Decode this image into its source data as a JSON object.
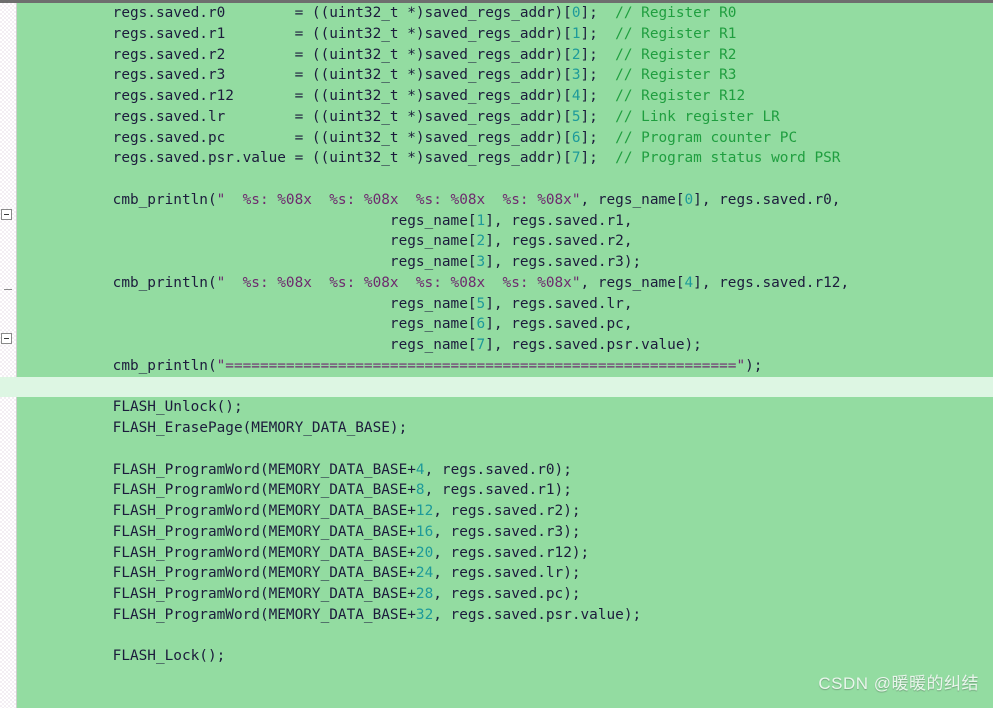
{
  "editor": {
    "background_color": "#93dca1",
    "caret_line_color": "#ddf6e3",
    "text_color": "#1c1c3c",
    "comment_color": "#1f9e3f",
    "string_color": "#6e2a6e",
    "number_color": "#1e9a9a",
    "language": "C"
  },
  "gutter": {
    "fold_markers": [
      {
        "name": "fold-marker-collapse-1",
        "glyph": "minus"
      },
      {
        "name": "fold-marker-collapse-2",
        "glyph": "minus"
      }
    ]
  },
  "watermark": {
    "text": "CSDN @暖暖的纠结"
  },
  "code": {
    "lines": [
      {
        "id": "line-assign-r0",
        "indent": "    ",
        "segments": [
          {
            "type": "plain",
            "text": "regs.saved.r0        = ((uint32_t *)saved_regs_addr)["
          },
          {
            "type": "number",
            "text": "0"
          },
          {
            "type": "plain",
            "text": "];  "
          },
          {
            "type": "comment",
            "text": "// Register R0"
          }
        ]
      },
      {
        "id": "line-assign-r1",
        "indent": "    ",
        "segments": [
          {
            "type": "plain",
            "text": "regs.saved.r1        = ((uint32_t *)saved_regs_addr)["
          },
          {
            "type": "number",
            "text": "1"
          },
          {
            "type": "plain",
            "text": "];  "
          },
          {
            "type": "comment",
            "text": "// Register R1"
          }
        ]
      },
      {
        "id": "line-assign-r2",
        "indent": "    ",
        "segments": [
          {
            "type": "plain",
            "text": "regs.saved.r2        = ((uint32_t *)saved_regs_addr)["
          },
          {
            "type": "number",
            "text": "2"
          },
          {
            "type": "plain",
            "text": "];  "
          },
          {
            "type": "comment",
            "text": "// Register R2"
          }
        ]
      },
      {
        "id": "line-assign-r3",
        "indent": "    ",
        "segments": [
          {
            "type": "plain",
            "text": "regs.saved.r3        = ((uint32_t *)saved_regs_addr)["
          },
          {
            "type": "number",
            "text": "3"
          },
          {
            "type": "plain",
            "text": "];  "
          },
          {
            "type": "comment",
            "text": "// Register R3"
          }
        ]
      },
      {
        "id": "line-assign-r12",
        "indent": "    ",
        "segments": [
          {
            "type": "plain",
            "text": "regs.saved.r12       = ((uint32_t *)saved_regs_addr)["
          },
          {
            "type": "number",
            "text": "4"
          },
          {
            "type": "plain",
            "text": "];  "
          },
          {
            "type": "comment",
            "text": "// Register R12"
          }
        ]
      },
      {
        "id": "line-assign-lr",
        "indent": "    ",
        "segments": [
          {
            "type": "plain",
            "text": "regs.saved.lr        = ((uint32_t *)saved_regs_addr)["
          },
          {
            "type": "number",
            "text": "5"
          },
          {
            "type": "plain",
            "text": "];  "
          },
          {
            "type": "comment",
            "text": "// Link register LR"
          }
        ]
      },
      {
        "id": "line-assign-pc",
        "indent": "    ",
        "segments": [
          {
            "type": "plain",
            "text": "regs.saved.pc        = ((uint32_t *)saved_regs_addr)["
          },
          {
            "type": "number",
            "text": "6"
          },
          {
            "type": "plain",
            "text": "];  "
          },
          {
            "type": "comment",
            "text": "// Program counter PC"
          }
        ]
      },
      {
        "id": "line-assign-psr",
        "indent": "    ",
        "segments": [
          {
            "type": "plain",
            "text": "regs.saved.psr.value = ((uint32_t *)saved_regs_addr)["
          },
          {
            "type": "number",
            "text": "7"
          },
          {
            "type": "plain",
            "text": "];  "
          },
          {
            "type": "comment",
            "text": "// Program status word PSR"
          }
        ]
      },
      {
        "id": "line-blank-1",
        "indent": "",
        "segments": []
      },
      {
        "id": "line-println-1",
        "indent": "    ",
        "segments": [
          {
            "type": "plain",
            "text": "cmb_println("
          },
          {
            "type": "string",
            "text": "\"  %s: %08x  %s: %08x  %s: %08x  %s: %08x\""
          },
          {
            "type": "plain",
            "text": ", regs_name["
          },
          {
            "type": "number",
            "text": "0"
          },
          {
            "type": "plain",
            "text": "], regs.saved.r0,"
          }
        ]
      },
      {
        "id": "line-println-1-arg2",
        "indent": "                                    ",
        "segments": [
          {
            "type": "plain",
            "text": "regs_name["
          },
          {
            "type": "number",
            "text": "1"
          },
          {
            "type": "plain",
            "text": "], regs.saved.r1,"
          }
        ]
      },
      {
        "id": "line-println-1-arg3",
        "indent": "                                    ",
        "segments": [
          {
            "type": "plain",
            "text": "regs_name["
          },
          {
            "type": "number",
            "text": "2"
          },
          {
            "type": "plain",
            "text": "], regs.saved.r2,"
          }
        ]
      },
      {
        "id": "line-println-1-arg4",
        "indent": "                                    ",
        "segments": [
          {
            "type": "plain",
            "text": "regs_name["
          },
          {
            "type": "number",
            "text": "3"
          },
          {
            "type": "plain",
            "text": "], regs.saved.r3);"
          }
        ]
      },
      {
        "id": "line-println-2",
        "indent": "    ",
        "segments": [
          {
            "type": "plain",
            "text": "cmb_println("
          },
          {
            "type": "string",
            "text": "\"  %s: %08x  %s: %08x  %s: %08x  %s: %08x\""
          },
          {
            "type": "plain",
            "text": ", regs_name["
          },
          {
            "type": "number",
            "text": "4"
          },
          {
            "type": "plain",
            "text": "], regs.saved.r12,"
          }
        ]
      },
      {
        "id": "line-println-2-arg2",
        "indent": "                                    ",
        "segments": [
          {
            "type": "plain",
            "text": "regs_name["
          },
          {
            "type": "number",
            "text": "5"
          },
          {
            "type": "plain",
            "text": "], regs.saved.lr,"
          }
        ]
      },
      {
        "id": "line-println-2-arg3",
        "indent": "                                    ",
        "segments": [
          {
            "type": "plain",
            "text": "regs_name["
          },
          {
            "type": "number",
            "text": "6"
          },
          {
            "type": "plain",
            "text": "], regs.saved.pc,"
          }
        ]
      },
      {
        "id": "line-println-2-arg4",
        "indent": "                                    ",
        "segments": [
          {
            "type": "plain",
            "text": "regs_name["
          },
          {
            "type": "number",
            "text": "7"
          },
          {
            "type": "plain",
            "text": "], regs.saved.psr.value);"
          }
        ]
      },
      {
        "id": "line-println-separator",
        "indent": "    ",
        "segments": [
          {
            "type": "plain",
            "text": "cmb_println("
          },
          {
            "type": "string",
            "text": "\"===========================================================\""
          },
          {
            "type": "plain",
            "text": ");"
          }
        ]
      },
      {
        "id": "line-blank-caret",
        "indent": "",
        "caret": true,
        "segments": []
      },
      {
        "id": "line-flash-unlock",
        "indent": "    ",
        "segments": [
          {
            "type": "plain",
            "text": "FLASH_Unlock();"
          }
        ]
      },
      {
        "id": "line-flash-erasepage",
        "indent": "    ",
        "segments": [
          {
            "type": "plain",
            "text": "FLASH_ErasePage(MEMORY_DATA_BASE);"
          }
        ]
      },
      {
        "id": "line-blank-2",
        "indent": "",
        "segments": []
      },
      {
        "id": "line-programword-r0",
        "indent": "    ",
        "segments": [
          {
            "type": "plain",
            "text": "FLASH_ProgramWord(MEMORY_DATA_BASE+"
          },
          {
            "type": "number",
            "text": "4"
          },
          {
            "type": "plain",
            "text": ", regs.saved.r0);"
          }
        ]
      },
      {
        "id": "line-programword-r1",
        "indent": "    ",
        "segments": [
          {
            "type": "plain",
            "text": "FLASH_ProgramWord(MEMORY_DATA_BASE+"
          },
          {
            "type": "number",
            "text": "8"
          },
          {
            "type": "plain",
            "text": ", regs.saved.r1);"
          }
        ]
      },
      {
        "id": "line-programword-r2",
        "indent": "    ",
        "segments": [
          {
            "type": "plain",
            "text": "FLASH_ProgramWord(MEMORY_DATA_BASE+"
          },
          {
            "type": "number",
            "text": "12"
          },
          {
            "type": "plain",
            "text": ", regs.saved.r2);"
          }
        ]
      },
      {
        "id": "line-programword-r3",
        "indent": "    ",
        "segments": [
          {
            "type": "plain",
            "text": "FLASH_ProgramWord(MEMORY_DATA_BASE+"
          },
          {
            "type": "number",
            "text": "16"
          },
          {
            "type": "plain",
            "text": ", regs.saved.r3);"
          }
        ]
      },
      {
        "id": "line-programword-r12",
        "indent": "    ",
        "segments": [
          {
            "type": "plain",
            "text": "FLASH_ProgramWord(MEMORY_DATA_BASE+"
          },
          {
            "type": "number",
            "text": "20"
          },
          {
            "type": "plain",
            "text": ", regs.saved.r12);"
          }
        ]
      },
      {
        "id": "line-programword-lr",
        "indent": "    ",
        "segments": [
          {
            "type": "plain",
            "text": "FLASH_ProgramWord(MEMORY_DATA_BASE+"
          },
          {
            "type": "number",
            "text": "24"
          },
          {
            "type": "plain",
            "text": ", regs.saved.lr);"
          }
        ]
      },
      {
        "id": "line-programword-pc",
        "indent": "    ",
        "segments": [
          {
            "type": "plain",
            "text": "FLASH_ProgramWord(MEMORY_DATA_BASE+"
          },
          {
            "type": "number",
            "text": "28"
          },
          {
            "type": "plain",
            "text": ", regs.saved.pc);"
          }
        ]
      },
      {
        "id": "line-programword-psr",
        "indent": "    ",
        "segments": [
          {
            "type": "plain",
            "text": "FLASH_ProgramWord(MEMORY_DATA_BASE+"
          },
          {
            "type": "number",
            "text": "32"
          },
          {
            "type": "plain",
            "text": ", regs.saved.psr.value);"
          }
        ]
      },
      {
        "id": "line-blank-3",
        "indent": "",
        "segments": []
      },
      {
        "id": "line-flash-lock",
        "indent": "    ",
        "segments": [
          {
            "type": "plain",
            "text": "FLASH_Lock();"
          }
        ]
      }
    ]
  }
}
